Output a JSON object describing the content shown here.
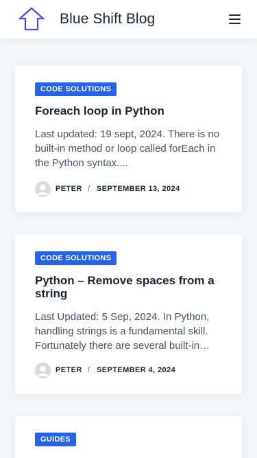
{
  "header": {
    "site_title": "Blue Shift Blog",
    "logo_icon": "house-arrow-icon",
    "menu_icon": "hamburger-menu-icon"
  },
  "colors": {
    "accent": "#2563eb",
    "logo": "#4f46e5",
    "text": "#1c2434",
    "background": "#f6f7f9"
  },
  "posts": [
    {
      "category": "CODE SOLUTIONS",
      "title": "Foreach loop in Python",
      "excerpt": "Last updated: 19 sept, 2024. There is no built-in method or loop called forEach in the Python syntax....",
      "author": "PETER",
      "separator": "/",
      "date": "SEPTEMBER 13, 2024"
    },
    {
      "category": "CODE SOLUTIONS",
      "title": "Python – Remove spaces from a string",
      "excerpt": "Last Updated: 5 Sep, 2024. In Python, handling strings is a fundamental skill. Fortunately there are several built-in…",
      "author": "PETER",
      "separator": "/",
      "date": "SEPTEMBER 4, 2024"
    },
    {
      "category": "GUIDES"
    }
  ]
}
